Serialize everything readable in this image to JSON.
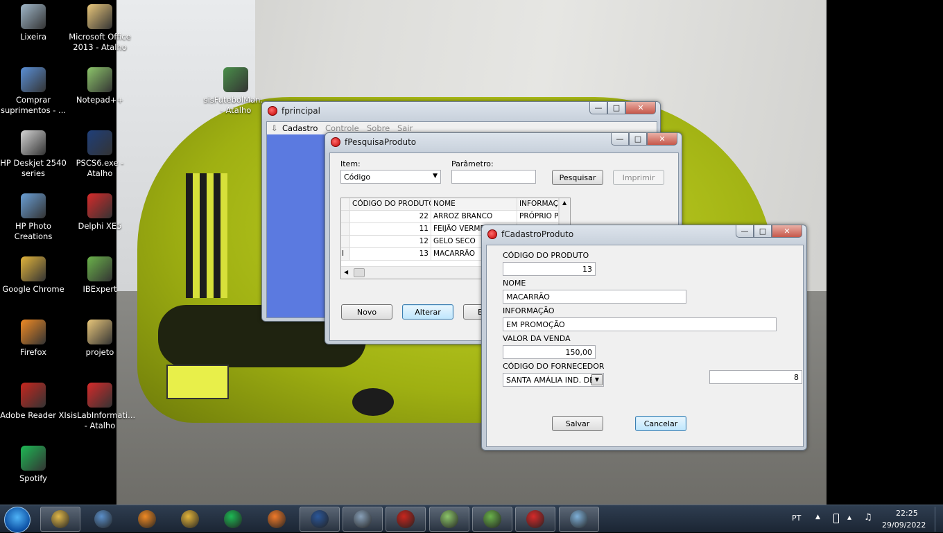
{
  "desktop": {
    "icons": [
      {
        "name": "recycle-bin",
        "label": "Lixeira",
        "color": "#9fb7c9"
      },
      {
        "name": "ms-office-shortcut",
        "label": "Microsoft Office 2013 - Atalho",
        "color": "#e8c67a"
      },
      {
        "name": "buy-supplies",
        "label": "Comprar suprimentos - ...",
        "color": "#5a8fd6"
      },
      {
        "name": "notepadpp",
        "label": "Notepad++",
        "color": "#8cc56a"
      },
      {
        "name": "sisfutebol-shortcut",
        "label": "sisFutebolMan... - Atalho",
        "color": "#4a8f4a"
      },
      {
        "name": "hp-deskjet",
        "label": "HP Deskjet 2540 series",
        "color": "#d4d4d4"
      },
      {
        "name": "photoshop",
        "label": "PSCS6.exe - Atalho",
        "color": "#1f3f7a"
      },
      {
        "name": "hp-photo",
        "label": "HP Photo Creations",
        "color": "#6a9fd6"
      },
      {
        "name": "delphi",
        "label": "Delphi XE5",
        "color": "#d62a2a"
      },
      {
        "name": "chrome",
        "label": "Google Chrome",
        "color": "#e2b43b"
      },
      {
        "name": "ibexpert",
        "label": "IBExpert",
        "color": "#6ab24a"
      },
      {
        "name": "firefox",
        "label": "Firefox",
        "color": "#f08a24"
      },
      {
        "name": "projeto",
        "label": "projeto",
        "color": "#e8c67a"
      },
      {
        "name": "adobe-reader",
        "label": "Adobe Reader XI",
        "color": "#c8261e"
      },
      {
        "name": "sislab-shortcut",
        "label": "sisLabInformati... - Atalho",
        "color": "#d62a2a"
      },
      {
        "name": "spotify",
        "label": "Spotify",
        "color": "#1db954"
      }
    ]
  },
  "fprincipal": {
    "title": "fprincipal",
    "menu": [
      "Cadastro",
      "Controle",
      "Sobre",
      "Sair"
    ]
  },
  "fpesquisa": {
    "title": "fPesquisaProduto",
    "item_label": "Item:",
    "item_value": "Código",
    "param_label": "Parâmetro:",
    "param_value": "",
    "search_button": "Pesquisar",
    "print_button": "Imprimir",
    "grid": {
      "columns": [
        "CÓDIGO DO PRODUTO",
        "NOME",
        "INFORMAÇ"
      ],
      "rows": [
        {
          "code": "22",
          "name": "ARROZ BRANCO",
          "info": "PRÓPRIO P"
        },
        {
          "code": "11",
          "name": "FEIJÃO VERME",
          "info": ""
        },
        {
          "code": "12",
          "name": "GELO SECO",
          "info": ""
        },
        {
          "code": "13",
          "name": "MACARRÃO",
          "info": ""
        }
      ],
      "current_row_marker": "I"
    },
    "new_button": "Novo",
    "edit_button": "Alterar",
    "delete_button_partial": "E"
  },
  "fcadastro": {
    "title": "fCadastroProduto",
    "code_label": "CÓDIGO DO PRODUTO",
    "code_value": "13",
    "name_label": "NOME",
    "name_value": "MACARRÃO",
    "info_label": "INFORMAÇÃO",
    "info_value": "EM PROMOÇÃO",
    "price_label": "VALOR DA VENDA",
    "price_value": "150,00",
    "supplier_label": "CÓDIGO DO FORNECEDOR",
    "supplier_value": "SANTA AMÁLIA IND. DE A",
    "supplier_code": "8",
    "save_button": "Salvar",
    "cancel_button": "Cancelar"
  },
  "taskbar": {
    "apps": [
      "file-explorer",
      "media-player",
      "firefox",
      "chrome",
      "spotify",
      "xampp",
      "word",
      "generic-app",
      "adobe-reader",
      "notepadpp",
      "ibexpert",
      "delphi",
      "paint"
    ],
    "language": "PT",
    "time": "22:25",
    "date": "29/09/2022"
  }
}
